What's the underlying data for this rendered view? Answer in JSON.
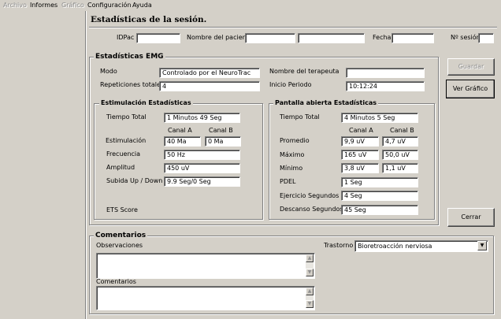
{
  "menu": {
    "items": [
      "Archivo",
      "Informes",
      "Gráfico",
      "Configuración",
      "Ayuda"
    ]
  },
  "session": {
    "title": "Estadísticas de la sesión.",
    "idpac_label": "IDPac",
    "idpac_value": "",
    "patient_label": "Nombre del paciente",
    "patient_first": "",
    "patient_last": "",
    "date_label": "Fecha",
    "date_value": "",
    "session_no_label": "Nº sesión",
    "session_no_value": ""
  },
  "emg": {
    "legend": "Estadísticas EMG",
    "mode_label": "Modo",
    "mode_value": "Controlado por el NeuroTrac",
    "therapist_label": "Nombre del terapeuta",
    "therapist_value": "",
    "reps_label": "Repeticiones totales",
    "reps_value": "4",
    "start_label": "Inicio Periodo",
    "start_value": "10:12:24"
  },
  "stim": {
    "legend": "Estimulación Estadísticas",
    "total_time_label": "Tiempo Total",
    "total_time_value": "1 Minutos 49 Seg",
    "canal_a": "Canal A",
    "canal_b": "Canal B",
    "stim_label": "Estimulación",
    "stim_a": "40 Ma",
    "stim_b": "0 Ma",
    "freq_label": "Frecuencia",
    "freq_value": "50 Hz",
    "amp_label": "Amplitud",
    "amp_value": "450 uV",
    "ramp_label": "Subida Up / Down",
    "ramp_value": "9.9 Seg/0 Seg",
    "ets_label": "ETS Score"
  },
  "screen": {
    "legend": "Pantalla abierta Estadísticas",
    "total_time_label": "Tiempo Total",
    "total_time_value": "4 Minutos 5 Seg",
    "canal_a": "Canal A",
    "canal_b": "Canal B",
    "avg_label": "Promedio",
    "avg_a": "9,9 uV",
    "avg_b": "4,7 uV",
    "max_label": "Máximo",
    "max_a": "165 uV",
    "max_b": "50,0 uV",
    "min_label": "Mínimo",
    "min_a": "3,8 uV",
    "min_b": "1,1 uV",
    "pdel_label": "PDEL",
    "pdel_value": "1 Seg",
    "exercise_label": "Ejercicio Segundos",
    "exercise_value": "4 Seg",
    "rest_label": "Descanso Segundos",
    "rest_value": "45 Seg"
  },
  "buttons": {
    "save": "Guardar",
    "view_graph": "Ver Gráfico",
    "close": "Cerrar"
  },
  "comments": {
    "legend": "Comentarios",
    "observations_label": "Observaciones",
    "observations_value": "",
    "comments_label": "Comentarios",
    "comments_value": "",
    "disorder_label": "Trastorno",
    "disorder_value": "Bioretroacción nerviosa"
  },
  "icons": {
    "scroll_up": "▲",
    "scroll_down": "▼",
    "dropdown": "▼"
  }
}
